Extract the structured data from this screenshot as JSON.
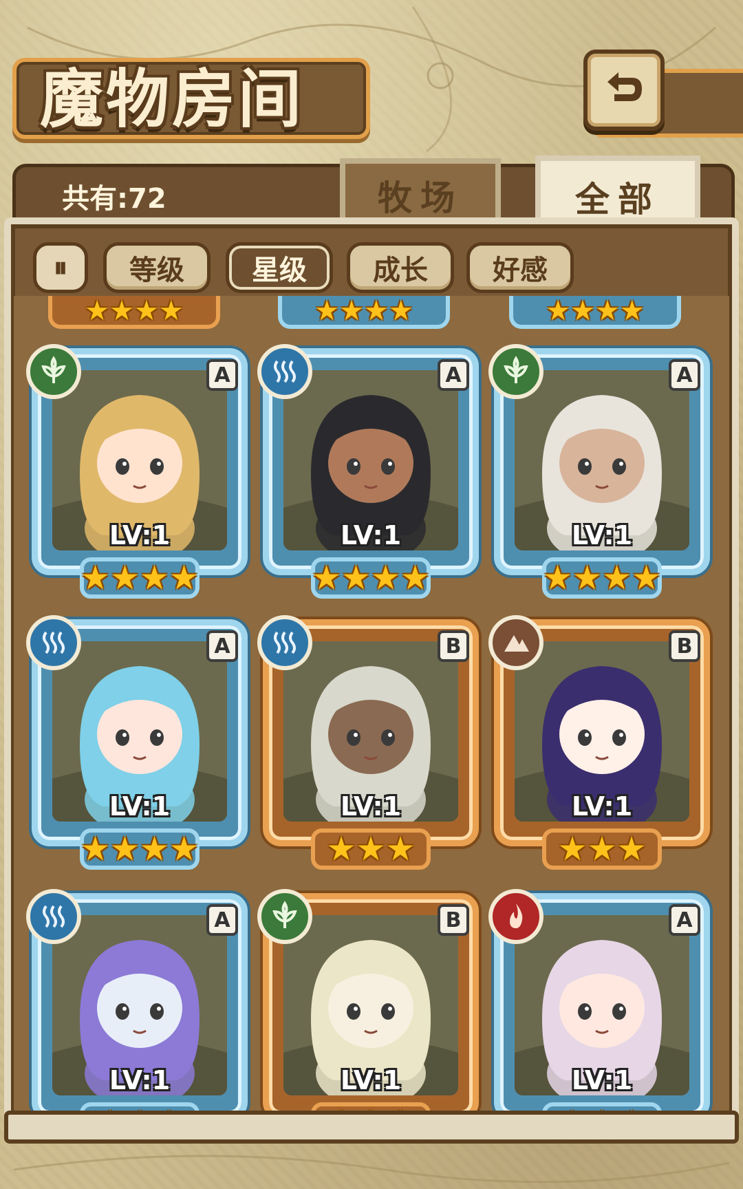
{
  "header": {
    "title": "魔物房间",
    "count_text": "共有:72",
    "tabs": {
      "ranch": "牧场",
      "all": "全部"
    }
  },
  "filters": {
    "sort_icon": "⏸",
    "items": [
      {
        "label": "等级",
        "active": false
      },
      {
        "label": "星级",
        "active": true
      },
      {
        "label": "成长",
        "active": false
      },
      {
        "label": "好感",
        "active": false
      }
    ]
  },
  "colors": {
    "accent_blue": "#9fd6ee",
    "accent_orange": "#e9a050",
    "star": "#ffc21a"
  },
  "monsters": [
    {
      "element": "leaf",
      "rank": "A",
      "level": "LV:1",
      "stars": "★★★★",
      "frame": "blue"
    },
    {
      "element": "water",
      "rank": "A",
      "level": "LV:1",
      "stars": "★★★★",
      "frame": "blue"
    },
    {
      "element": "leaf",
      "rank": "A",
      "level": "LV:1",
      "stars": "★★★★",
      "frame": "blue"
    },
    {
      "element": "water",
      "rank": "A",
      "level": "LV:1",
      "stars": "★★★★",
      "frame": "blue"
    },
    {
      "element": "water",
      "rank": "B",
      "level": "LV:1",
      "stars": "★★★",
      "frame": "orange"
    },
    {
      "element": "earth",
      "rank": "B",
      "level": "LV:1",
      "stars": "★★★",
      "frame": "orange"
    },
    {
      "element": "water",
      "rank": "A",
      "level": "LV:1",
      "stars": "★★★",
      "frame": "blue"
    },
    {
      "element": "leaf",
      "rank": "B",
      "level": "LV:1",
      "stars": "★★★",
      "frame": "orange"
    },
    {
      "element": "fire",
      "rank": "A",
      "level": "LV:1",
      "stars": "★★★",
      "frame": "blue"
    }
  ],
  "partial_row": {
    "stars": "★★★★"
  }
}
